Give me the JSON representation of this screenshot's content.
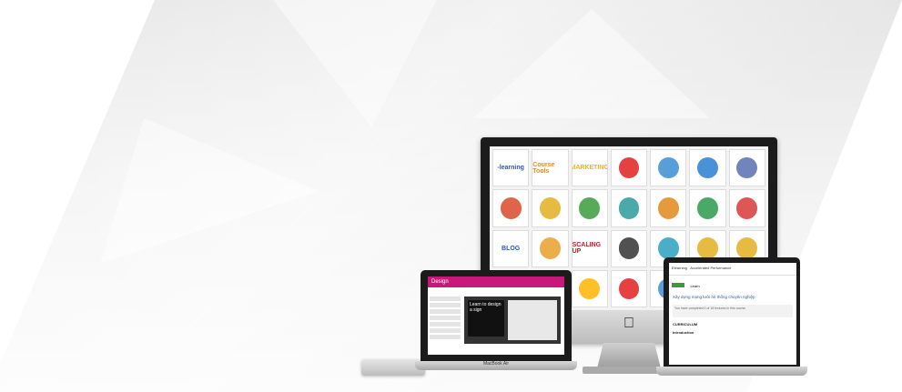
{
  "imac_tiles": [
    "-learning",
    "Course Tools",
    "MARKETING",
    "",
    "",
    "",
    "",
    "",
    "",
    "",
    "",
    "",
    "",
    "",
    "BLOG",
    "",
    "SCALING UP",
    "",
    "",
    "",
    "",
    "",
    "",
    "",
    "",
    "",
    "",
    ""
  ],
  "laptop_left": {
    "header": "Design",
    "panel_text": "Learn to design a sign",
    "footer": "MacBook Air"
  },
  "laptop_right": {
    "brand": "Elearning",
    "top_label": "Accelerated Performance",
    "button_label": "Learn",
    "course_title": "Xây dựng mạng lưới hệ thống chuyên nghiệp",
    "progress_text": "You have completed 0 of 18 lectures in this course",
    "section_label": "CURRICULUM",
    "intro_label": "Introduction"
  }
}
